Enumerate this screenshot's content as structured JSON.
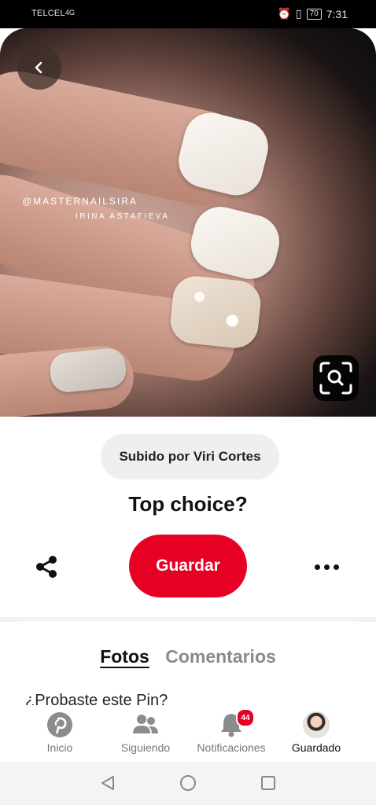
{
  "status_bar": {
    "carrier": "TELCEL",
    "signal": "4G",
    "battery": "70",
    "time": "7:31"
  },
  "image": {
    "watermark_handle": "@MASTERNAILSIRA",
    "watermark_name": "IRINA ASTAFIEVA"
  },
  "pin": {
    "uploader": "Subido por Viri Cortes",
    "title": "Top choice?",
    "save_label": "Guardar"
  },
  "tabs": {
    "photos": "Fotos",
    "comments": "Comentarios"
  },
  "prompt": {
    "question": "¿Probaste este Pin?"
  },
  "bottom_nav": {
    "home": "Inicio",
    "following": "Siguiendo",
    "notifications": "Notificaciones",
    "notifications_count": "44",
    "saved": "Guardado"
  },
  "colors": {
    "brand_red": "#e60023",
    "pill_bg": "#efefef",
    "inactive_text": "#767676"
  }
}
